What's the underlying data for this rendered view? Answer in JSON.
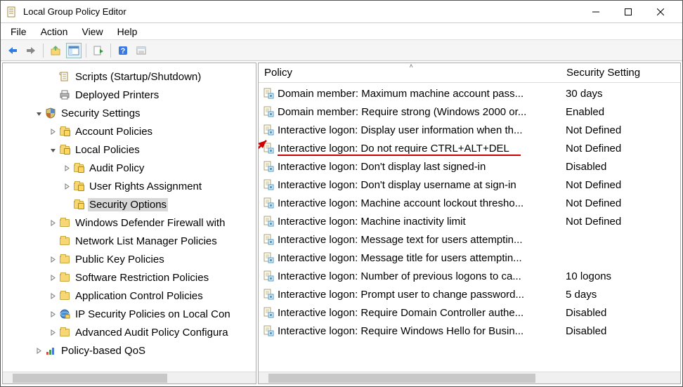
{
  "window": {
    "title": "Local Group Policy Editor"
  },
  "menu": {
    "file": "File",
    "action": "Action",
    "view": "View",
    "help": "Help"
  },
  "tree": [
    {
      "indent": 40,
      "exp": "",
      "icon": "scroll",
      "label": "Scripts (Startup/Shutdown)"
    },
    {
      "indent": 40,
      "exp": "",
      "icon": "printer",
      "label": "Deployed Printers"
    },
    {
      "indent": 20,
      "exp": "v",
      "icon": "shield",
      "label": "Security Settings"
    },
    {
      "indent": 40,
      "exp": ">",
      "icon": "folderlock",
      "label": "Account Policies"
    },
    {
      "indent": 40,
      "exp": "v",
      "icon": "folderlock",
      "label": "Local Policies"
    },
    {
      "indent": 60,
      "exp": ">",
      "icon": "folderlock",
      "label": "Audit Policy"
    },
    {
      "indent": 60,
      "exp": ">",
      "icon": "folderlock",
      "label": "User Rights Assignment"
    },
    {
      "indent": 60,
      "exp": "",
      "icon": "folderlock",
      "label": "Security Options",
      "selected": true
    },
    {
      "indent": 40,
      "exp": ">",
      "icon": "folder",
      "label": "Windows Defender Firewall with"
    },
    {
      "indent": 40,
      "exp": "",
      "icon": "folder",
      "label": "Network List Manager Policies"
    },
    {
      "indent": 40,
      "exp": ">",
      "icon": "folder",
      "label": "Public Key Policies"
    },
    {
      "indent": 40,
      "exp": ">",
      "icon": "folder",
      "label": "Software Restriction Policies"
    },
    {
      "indent": 40,
      "exp": ">",
      "icon": "folder",
      "label": "Application Control Policies"
    },
    {
      "indent": 40,
      "exp": ">",
      "icon": "ipsec",
      "label": "IP Security Policies on Local Con"
    },
    {
      "indent": 40,
      "exp": ">",
      "icon": "folder",
      "label": "Advanced Audit Policy Configura"
    },
    {
      "indent": 20,
      "exp": ">",
      "icon": "qos",
      "label": "Policy-based QoS"
    }
  ],
  "columns": {
    "policy": "Policy",
    "setting": "Security Setting"
  },
  "policies": [
    {
      "name": "Domain member: Maximum machine account pass...",
      "setting": "30 days"
    },
    {
      "name": "Domain member: Require strong (Windows 2000 or...",
      "setting": "Enabled"
    },
    {
      "name": "Interactive logon: Display user information when th...",
      "setting": "Not Defined"
    },
    {
      "name": "Interactive logon: Do not require CTRL+ALT+DEL",
      "setting": "Not Defined",
      "hl": true
    },
    {
      "name": "Interactive logon: Don't display last signed-in",
      "setting": "Disabled"
    },
    {
      "name": "Interactive logon: Don't display username at sign-in",
      "setting": "Not Defined"
    },
    {
      "name": "Interactive logon: Machine account lockout thresho...",
      "setting": "Not Defined"
    },
    {
      "name": "Interactive logon: Machine inactivity limit",
      "setting": "Not Defined"
    },
    {
      "name": "Interactive logon: Message text for users attemptin...",
      "setting": ""
    },
    {
      "name": "Interactive logon: Message title for users attemptin...",
      "setting": ""
    },
    {
      "name": "Interactive logon: Number of previous logons to ca...",
      "setting": "10 logons"
    },
    {
      "name": "Interactive logon: Prompt user to change password...",
      "setting": "5 days"
    },
    {
      "name": "Interactive logon: Require Domain Controller authe...",
      "setting": "Disabled"
    },
    {
      "name": "Interactive logon: Require Windows Hello for Busin...",
      "setting": "Disabled"
    }
  ]
}
